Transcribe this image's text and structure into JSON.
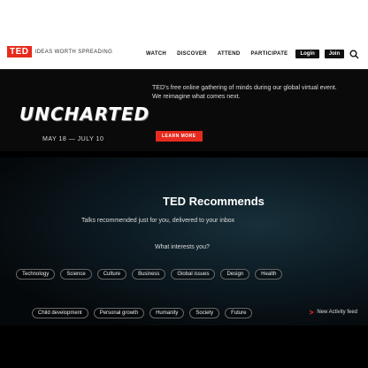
{
  "header": {
    "logo": "TED",
    "logo_sub": "IDEAS WORTH SPREADING",
    "nav": [
      "WATCH",
      "DISCOVER",
      "ATTEND",
      "PARTICIPATE"
    ],
    "buttons": [
      "Login",
      "Join"
    ],
    "search_icon": "search-icon"
  },
  "hero": {
    "title": "UNCHARTED",
    "description": "TED's free online gathering of minds during our global virtual event. We reimagine what comes next.",
    "dates": "MAY 18 — JULY 10",
    "cta": "LEARN MORE"
  },
  "recommends": {
    "title": "TED Recommends",
    "description": "Talks recommended just for you, delivered to your inbox",
    "question": "What interests you?",
    "topics_row1": [
      "Technology",
      "Science",
      "Culture",
      "Business",
      "Global issues",
      "Design",
      "Health"
    ],
    "topics_row2": [
      "Child development",
      "Personal growth",
      "Humanity",
      "Society",
      "Future"
    ],
    "feed_link": "New Activity feed"
  },
  "colors": {
    "brand": "#e62b1e",
    "bg": "#000000"
  }
}
